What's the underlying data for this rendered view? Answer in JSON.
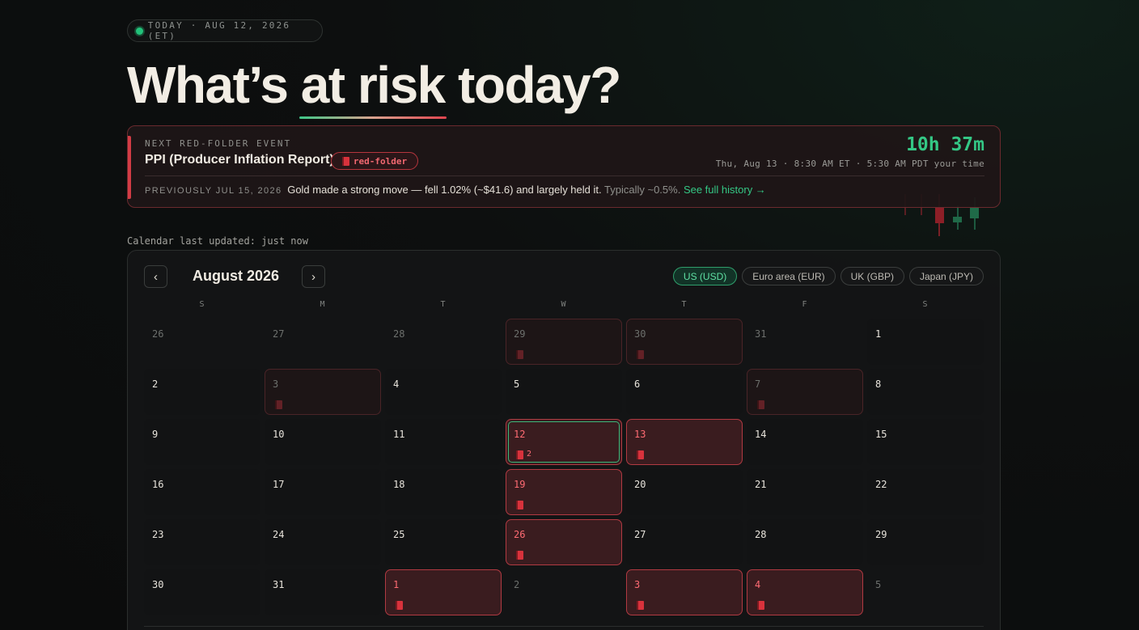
{
  "today_pill": {
    "text": "TODAY · AUG 12, 2026 (ET)"
  },
  "headline": {
    "before": "What’s ",
    "highlight": "at risk",
    "after": " today?"
  },
  "next_event": {
    "eyebrow": "NEXT RED-FOLDER EVENT",
    "title": "PPI (Producer Inflation Report)",
    "badge": "red-folder",
    "countdown": "10h 37m",
    "when": "Thu, Aug 13 · 8:30 AM ET · 5:30 AM PDT your time",
    "previous_label": "PREVIOUSLY JUL 15, 2026",
    "previous_text": "Gold made a strong move — fell 1.02% (~$41.6) and largely held it.",
    "typical_text": "Typically ~0.5%.",
    "history_link": "See full history →"
  },
  "calendar_updated": "Calendar last updated: just now",
  "calendar": {
    "month_title": "August 2026",
    "prev_label": "‹",
    "next_label": "›",
    "currencies": [
      {
        "label": "US (USD)",
        "active": true
      },
      {
        "label": "Euro area (EUR)",
        "active": false
      },
      {
        "label": "UK (GBP)",
        "active": false
      },
      {
        "label": "Japan (JPY)",
        "active": false
      }
    ],
    "weekdays": [
      "S",
      "M",
      "T",
      "W",
      "T",
      "F",
      "S"
    ],
    "weeks": [
      [
        {
          "d": "26",
          "s": "out"
        },
        {
          "d": "27",
          "s": "out"
        },
        {
          "d": "28",
          "s": "out"
        },
        {
          "d": "29",
          "s": "out-rf"
        },
        {
          "d": "30",
          "s": "out-rf"
        },
        {
          "d": "31",
          "s": "out"
        },
        {
          "d": "1",
          "s": "in"
        }
      ],
      [
        {
          "d": "2",
          "s": "in"
        },
        {
          "d": "3",
          "s": "out-rf"
        },
        {
          "d": "4",
          "s": "in"
        },
        {
          "d": "5",
          "s": "in"
        },
        {
          "d": "6",
          "s": "in"
        },
        {
          "d": "7",
          "s": "out-rf"
        },
        {
          "d": "8",
          "s": "in"
        }
      ],
      [
        {
          "d": "9",
          "s": "in"
        },
        {
          "d": "10",
          "s": "in"
        },
        {
          "d": "11",
          "s": "in"
        },
        {
          "d": "12",
          "s": "today",
          "count": "2"
        },
        {
          "d": "13",
          "s": "rf"
        },
        {
          "d": "14",
          "s": "in"
        },
        {
          "d": "15",
          "s": "in"
        }
      ],
      [
        {
          "d": "16",
          "s": "in"
        },
        {
          "d": "17",
          "s": "in"
        },
        {
          "d": "18",
          "s": "in"
        },
        {
          "d": "19",
          "s": "rf"
        },
        {
          "d": "20",
          "s": "in"
        },
        {
          "d": "21",
          "s": "in"
        },
        {
          "d": "22",
          "s": "in"
        }
      ],
      [
        {
          "d": "23",
          "s": "in"
        },
        {
          "d": "24",
          "s": "in"
        },
        {
          "d": "25",
          "s": "in"
        },
        {
          "d": "26",
          "s": "rf"
        },
        {
          "d": "27",
          "s": "in"
        },
        {
          "d": "28",
          "s": "in"
        },
        {
          "d": "29",
          "s": "in"
        }
      ],
      [
        {
          "d": "30",
          "s": "in"
        },
        {
          "d": "31",
          "s": "in"
        },
        {
          "d": "1",
          "s": "rf"
        },
        {
          "d": "2",
          "s": "out"
        },
        {
          "d": "3",
          "s": "rf"
        },
        {
          "d": "4",
          "s": "rf"
        },
        {
          "d": "5",
          "s": "out"
        }
      ]
    ]
  },
  "colors": {
    "accent_green": "#34c785",
    "red_folder": "#d8323c"
  }
}
